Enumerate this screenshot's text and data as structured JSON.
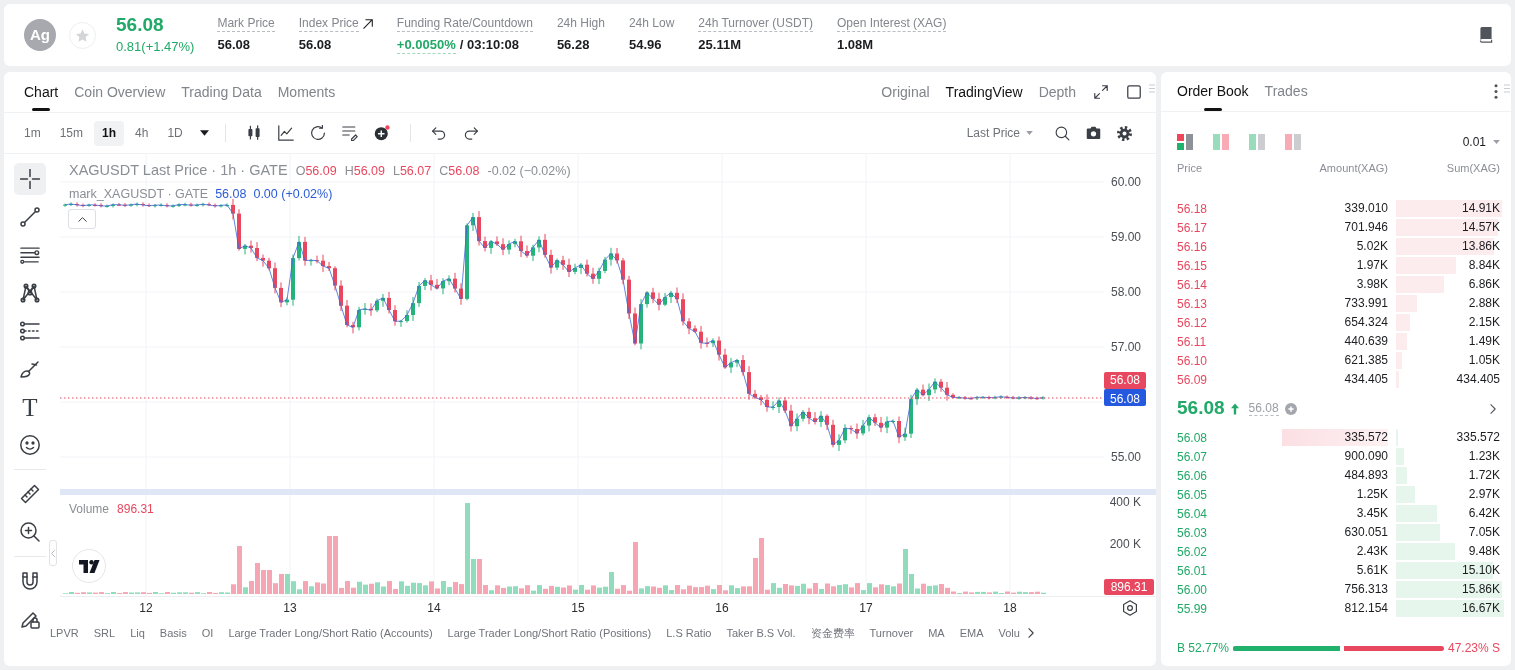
{
  "header": {
    "symbol": "Ag",
    "favorite": false,
    "rising": true,
    "price": "56.08",
    "change": "0.81(+1.47%)",
    "stats": [
      {
        "kind": "plain",
        "label": "Mark Price",
        "underlined": true,
        "value": "56.08"
      },
      {
        "kind": "link",
        "label": "Index Price",
        "underlined": true,
        "value": "56.08"
      },
      {
        "kind": "funding",
        "label": "Funding Rate/Countdown",
        "underlined": true,
        "rate": "+0.0050%",
        "countdown": "/ 03:10:08"
      },
      {
        "kind": "plain",
        "label": "24h High",
        "underlined": false,
        "value": "56.28"
      },
      {
        "kind": "plain",
        "label": "24h Low",
        "underlined": false,
        "value": "54.96"
      },
      {
        "kind": "plain",
        "label": "24h Turnover (USDT)",
        "underlined": true,
        "value": "25.11M"
      },
      {
        "kind": "plain",
        "label": "Open Interest (XAG)",
        "underlined": true,
        "value": "1.08M"
      }
    ]
  },
  "chart_panel": {
    "tabs": [
      {
        "label": "Chart",
        "selected": true
      },
      {
        "label": "Coin Overview",
        "selected": false
      },
      {
        "label": "Trading Data",
        "selected": false
      },
      {
        "label": "Moments",
        "selected": false
      }
    ],
    "views": [
      {
        "label": "Original",
        "selected": false
      },
      {
        "label": "TradingView",
        "selected": true
      },
      {
        "label": "Depth",
        "selected": false
      }
    ],
    "intervals": [
      {
        "label": "1m",
        "selected": false
      },
      {
        "label": "15m",
        "selected": false
      },
      {
        "label": "1h",
        "selected": true
      },
      {
        "label": "4h",
        "selected": false
      },
      {
        "label": "1D",
        "selected": false
      }
    ],
    "price_source": "Last Price",
    "drawing_tools": [
      {
        "tools": [
          {
            "kind": "crosshair",
            "selected": true
          },
          {
            "kind": "trend-line",
            "selected": false
          },
          {
            "kind": "parallel-lines",
            "selected": false
          },
          {
            "kind": "pattern",
            "selected": false
          },
          {
            "kind": "fib",
            "selected": false
          },
          {
            "kind": "brush",
            "selected": false
          },
          {
            "kind": "text",
            "glyph": "T",
            "selected": false
          },
          {
            "kind": "emoji",
            "selected": false
          }
        ]
      },
      {
        "tools": [
          {
            "kind": "ruler",
            "selected": false
          },
          {
            "kind": "zoom",
            "selected": false
          }
        ]
      },
      {
        "tools": [
          {
            "kind": "magnet",
            "selected": false
          },
          {
            "kind": "lock",
            "selected": false
          }
        ]
      }
    ],
    "legend": {
      "title": "XAGUSDT Last Price · 1h · GATE",
      "rising": false,
      "ohlc": [
        {
          "key": "O",
          "value": "56.09"
        },
        {
          "key": "H",
          "value": "56.09"
        },
        {
          "key": "L",
          "value": "56.07"
        },
        {
          "key": "C",
          "value": "56.08"
        }
      ],
      "change": "-0.02 (−0.02%)"
    },
    "mark_legend": {
      "title": "mark_XAGUSDT · GATE",
      "value": "56.08",
      "change": "0.00 (+0.02%)"
    },
    "price_axis": [
      "60.00",
      "59.00",
      "58.00",
      "57.00",
      "55.00"
    ],
    "price_tags": [
      {
        "kind": "last",
        "value": "56.08"
      },
      {
        "kind": "mark",
        "value": "56.08"
      }
    ],
    "volume": {
      "title": "Volume",
      "value": "896.31",
      "axis": [
        "400 K",
        "200 K"
      ],
      "tag": "896.31"
    },
    "time_axis": [
      "12",
      "13",
      "14",
      "15",
      "16",
      "17",
      "18"
    ],
    "indicators": [
      "LPVR",
      "SRL",
      "Liq",
      "Basis",
      "OI",
      "Large Trader Long/Short Ratio (Accounts)",
      "Large Trader Long/Short Ratio (Positions)",
      "L.S Ratio",
      "Taker B.S Vol.",
      "资金费率",
      "Turnover",
      "MA",
      "EMA",
      "Volu"
    ]
  },
  "order_book": {
    "tabs": [
      {
        "label": "Order Book",
        "selected": true
      },
      {
        "label": "Trades",
        "selected": false
      }
    ],
    "layouts": [
      {
        "kind": "both",
        "selected": true
      },
      {
        "kind": "split",
        "selected": false
      },
      {
        "kind": "bids",
        "selected": false
      },
      {
        "kind": "asks",
        "selected": false
      }
    ],
    "precision": "0.01",
    "columns": [
      "Price",
      "Amount(XAG)",
      "Sum(XAG)"
    ],
    "asks": [
      {
        "price": "56.18",
        "amount": "339.010",
        "sum": "14.91K",
        "level": 0.98
      },
      {
        "price": "56.17",
        "amount": "701.946",
        "sum": "14.57K",
        "level": 0.94
      },
      {
        "price": "56.16",
        "amount": "5.02K",
        "sum": "13.86K",
        "level": 0.91
      },
      {
        "price": "56.15",
        "amount": "1.97K",
        "sum": "8.84K",
        "level": 0.56
      },
      {
        "price": "56.14",
        "amount": "3.98K",
        "sum": "6.86K",
        "level": 0.44
      },
      {
        "price": "56.13",
        "amount": "733.991",
        "sum": "2.88K",
        "level": 0.19
      },
      {
        "price": "56.12",
        "amount": "654.324",
        "sum": "2.15K",
        "level": 0.13
      },
      {
        "price": "56.11",
        "amount": "440.639",
        "sum": "1.49K",
        "level": 0.1
      },
      {
        "price": "56.10",
        "amount": "621.385",
        "sum": "1.05K",
        "level": 0.06
      },
      {
        "price": "56.09",
        "amount": "434.405",
        "sum": "434.405",
        "level": 0.03
      }
    ],
    "last": {
      "price": "56.08",
      "rising": true,
      "mark": "56.08"
    },
    "bids": [
      {
        "price": "56.08",
        "amount": "335.572",
        "sum": "335.572",
        "level": 0.02,
        "highlighted": true
      },
      {
        "price": "56.07",
        "amount": "900.090",
        "sum": "1.23K",
        "level": 0.07,
        "highlighted": false
      },
      {
        "price": "56.06",
        "amount": "484.893",
        "sum": "1.72K",
        "level": 0.1,
        "highlighted": false
      },
      {
        "price": "56.05",
        "amount": "1.25K",
        "sum": "2.97K",
        "level": 0.18,
        "highlighted": false
      },
      {
        "price": "56.04",
        "amount": "3.45K",
        "sum": "6.42K",
        "level": 0.38,
        "highlighted": false
      },
      {
        "price": "56.03",
        "amount": "630.051",
        "sum": "7.05K",
        "level": 0.41,
        "highlighted": false
      },
      {
        "price": "56.02",
        "amount": "2.43K",
        "sum": "9.48K",
        "level": 0.55,
        "highlighted": false
      },
      {
        "price": "56.01",
        "amount": "5.61K",
        "sum": "15.10K",
        "level": 0.9,
        "highlighted": false
      },
      {
        "price": "56.00",
        "amount": "756.313",
        "sum": "15.86K",
        "level": 0.98,
        "highlighted": false
      },
      {
        "price": "55.99",
        "amount": "812.154",
        "sum": "16.67K",
        "level": 1.0,
        "highlighted": false
      }
    ],
    "ratio": {
      "buy": "B 52.77%",
      "sell": "47.23% S",
      "level": 0.5277
    }
  }
}
